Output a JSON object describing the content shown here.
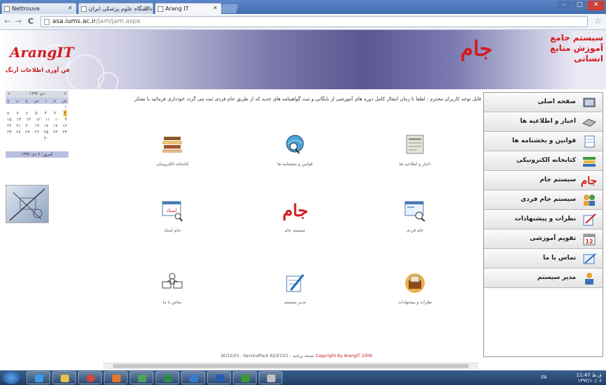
{
  "browser": {
    "tabs": [
      {
        "label": "Nettrouve"
      },
      {
        "label": "دانشگاه علوم پزشکی ایران"
      },
      {
        "label": "Arang IT"
      }
    ],
    "new_tab": "",
    "window_controls": {
      "minimize": "–",
      "maximize": "□",
      "close": "✕"
    },
    "nav": {
      "back": "←",
      "forward": "→",
      "reload": "C"
    },
    "url": {
      "host": "asa.iums.ac.ir",
      "path": "/jam/jam.aspx"
    }
  },
  "banner": {
    "logo": "ArangIT",
    "logo_sub": "فن آوری اطلاعات آرنگ",
    "jam_title": "جام",
    "system_title": "سیستم جامع آموزش منابع انسانی"
  },
  "calendar": {
    "header": [
      "»",
      "دی ۱۳۹۲",
      "«"
    ],
    "weekdays": [
      "ج",
      "پ",
      "چ",
      "س",
      "د",
      "ی",
      "ش"
    ],
    "rows": [
      [
        "",
        "",
        "",
        "",
        "",
        "",
        "۱"
      ],
      [
        "۸",
        "۷",
        "۶",
        "۵",
        "۴",
        "۳",
        "۲"
      ],
      [
        "۱۵",
        "۱۴",
        "۱۳",
        "۱۲",
        "۱۱",
        "۱۰",
        "۹"
      ],
      [
        "۲۲",
        "۲۱",
        "۲۰",
        "۱۹",
        "۱۸",
        "۱۷",
        "۱۶"
      ],
      [
        "۲۹",
        "۲۸",
        "۲۷",
        "۲۶",
        "۲۵",
        "۲۴",
        "۲۳"
      ],
      [
        "",
        "",
        "",
        "",
        "۳۰",
        "",
        ""
      ]
    ],
    "today_label": "امروز: ۶ دی ۱۳۹۲"
  },
  "notice": "قابل توجه کاربران محترم : لطفا تا زمان انتقال کامل دوره های آموزشی از بایگانی و ثبت گواهینامه های جدید که از طریق جام فردی ثبت می گردد خودداری فرمائید با تشکر",
  "grid": [
    {
      "label": "اخبار و اطلاعیه ها"
    },
    {
      "label": "قوانین و بخشنامه ها"
    },
    {
      "label": "کتابخانه الکترونیکی"
    },
    {
      "label": "جام فردی"
    },
    {
      "label": "سیستم جام"
    },
    {
      "label": "جام اسناد"
    },
    {
      "label": "نظرات و پیشنهادات"
    },
    {
      "label": "مدیر سیستم"
    },
    {
      "label": "تماس با ما"
    }
  ],
  "grid_icon_text": {
    "jam": "جام",
    "asnad": "اسناد"
  },
  "footer": {
    "version": "30/10/01 : ServicePack 92/07/21 : نسخه برنامه",
    "copyright": "Copyright By ArangIT 2006"
  },
  "menu": [
    {
      "label": "صفحه اصلی",
      "icon": "home-book-icon"
    },
    {
      "label": "اخبار و اطلاعیه ها",
      "icon": "news-icon"
    },
    {
      "label": "قوانین و بخشنامه ها",
      "icon": "document-icon"
    },
    {
      "label": "کتابخانه الکترونیکی",
      "icon": "books-icon"
    },
    {
      "label": "سیستم جام",
      "icon": "jam-logo-icon",
      "prefix": "جام"
    },
    {
      "label": "سیستم جام فردی",
      "icon": "users-icon"
    },
    {
      "label": "نظرات و پیشنهادات",
      "icon": "pencil-check-icon"
    },
    {
      "label": "تقویم آموزشی",
      "icon": "calendar-icon"
    },
    {
      "label": "تماس با ما",
      "icon": "contact-icon"
    },
    {
      "label": "مدیر سیستم",
      "icon": "admin-icon"
    }
  ],
  "taskbar": {
    "lang": "FA",
    "time": "11:47 ق.ظ",
    "date": "۱۳۹۲/۱۰/۰۶",
    "apps": [
      "ie-icon",
      "explorer-icon",
      "chrome-icon",
      "media-icon",
      "app-icon",
      "excel-icon",
      "network-icon",
      "word-icon",
      "excel2-icon",
      "paint-icon"
    ]
  },
  "colors": {
    "brand_red": "#d21c1c",
    "banner_purple": "#5a5792",
    "menu_bg": "#e4e4e4"
  }
}
